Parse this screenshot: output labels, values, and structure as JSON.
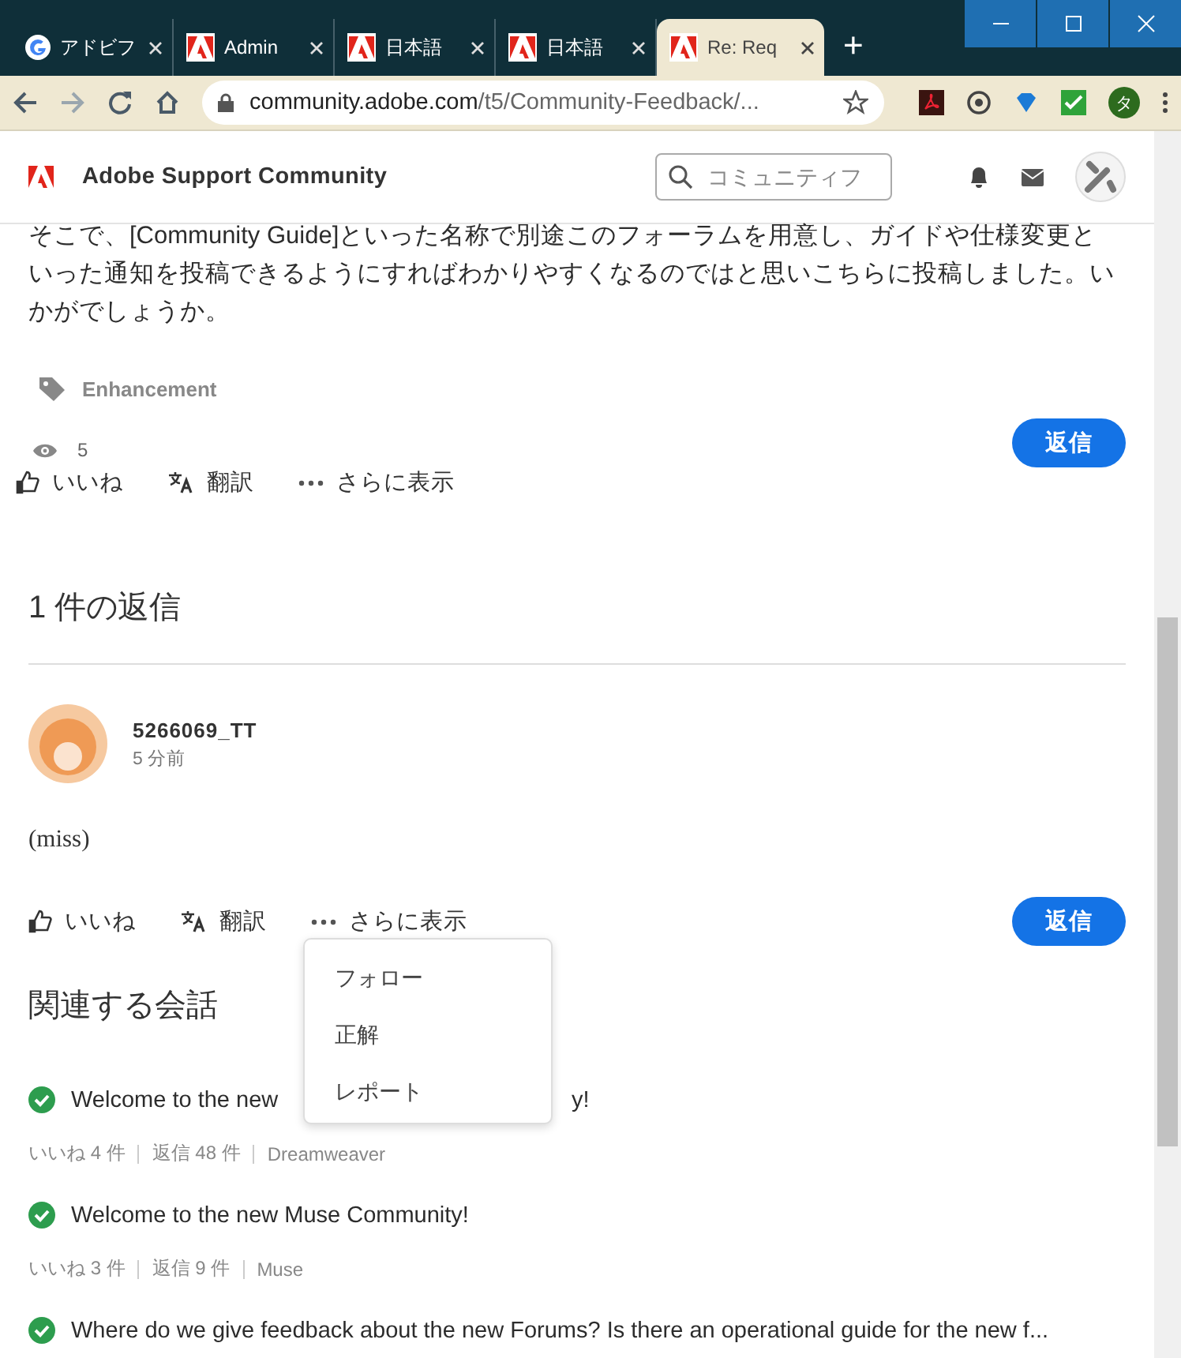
{
  "browser": {
    "tabs": [
      {
        "title": "アドビフ",
        "selected": false
      },
      {
        "title": "Admin",
        "selected": false
      },
      {
        "title": "日本語",
        "selected": false
      },
      {
        "title": "日本語",
        "selected": false
      },
      {
        "title": "Re: Req",
        "selected": true
      }
    ],
    "new_tab": "+",
    "url_host": "community.adobe.com",
    "url_path": "/t5/Community-Feedback/...",
    "profile": "タ"
  },
  "header": {
    "site_title": "Adobe Support Community",
    "search": {
      "placeholder": "コミュニティフ"
    }
  },
  "post": {
    "lines": [
      "そこで、[Community Guide]といった名称で別途このフォーラムを用意し、ガイドや仕様変更と",
      "いった通知を投稿できるようにすればわかりやすくなるのではと思いこちらに投稿しました。い",
      "かがでしょうか。"
    ],
    "tag": "Enhancement",
    "views": "5",
    "reply_button": "返信",
    "actions": [
      "いいね",
      "翻訳",
      "さらに表示"
    ]
  },
  "replies_heading": "1 件の返信",
  "reply": {
    "author": "5266069_TT",
    "time": "5 分前",
    "body": "(miss)",
    "actions": [
      "いいね",
      "翻訳",
      "さらに表示"
    ],
    "reply_button": "返信"
  },
  "menu": {
    "items": [
      "フォロー",
      "正解",
      "レポート"
    ]
  },
  "related": {
    "heading": "関連する会話",
    "items": [
      {
        "title": "Welcome to the new",
        "title_end": "y!",
        "solved": true,
        "likes": "いいね 4 件",
        "replies": "返信 48 件",
        "board": "Dreamweaver"
      },
      {
        "title": "Welcome to the new Muse Community!",
        "solved": true,
        "likes": "いいね 3 件",
        "replies": "返信 9 件",
        "board": "Muse"
      },
      {
        "title": "Where do we give feedback about the new Forums? Is there an operational guide for the new f...",
        "solved": true
      }
    ]
  }
}
